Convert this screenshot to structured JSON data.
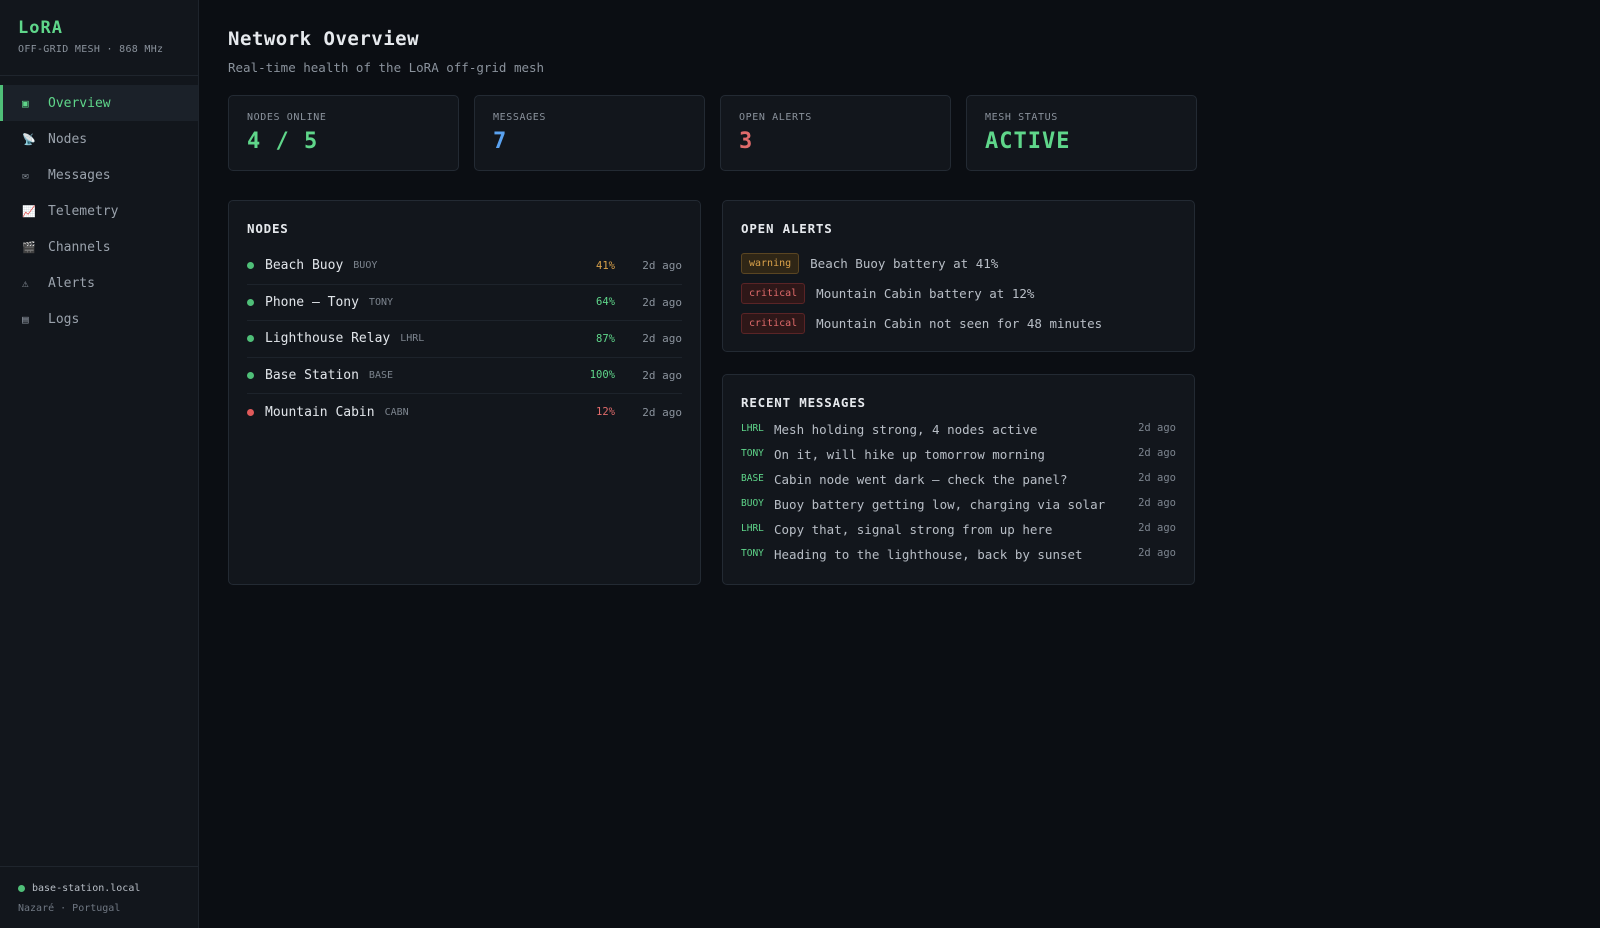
{
  "brand": {
    "title": "LoRA",
    "subtitle": "OFF-GRID MESH · 868 MHz"
  },
  "sidebar": {
    "items": [
      {
        "label": "Overview",
        "icon": "overview-icon",
        "glyph": "▣",
        "active": true
      },
      {
        "label": "Nodes",
        "icon": "satellite-dish-icon",
        "glyph": "📡",
        "active": false
      },
      {
        "label": "Messages",
        "icon": "envelope-icon",
        "glyph": "✉",
        "active": false
      },
      {
        "label": "Telemetry",
        "icon": "chart-icon",
        "glyph": "📈",
        "active": false
      },
      {
        "label": "Channels",
        "icon": "clapper-icon",
        "glyph": "🎬",
        "active": false
      },
      {
        "label": "Alerts",
        "icon": "warning-icon",
        "glyph": "⚠",
        "active": false
      },
      {
        "label": "Logs",
        "icon": "log-icon",
        "glyph": "▤",
        "active": false
      }
    ],
    "footer": {
      "host": "base-station.local",
      "location": "Nazaré · Portugal"
    }
  },
  "header": {
    "title": "Network Overview",
    "subtitle": "Real-time health of the LoRA off-grid mesh"
  },
  "stats": [
    {
      "label": "NODES ONLINE",
      "value": "4 / 5",
      "color": "#5fd68a"
    },
    {
      "label": "MESSAGES",
      "value": "7",
      "color": "#5aa2f0"
    },
    {
      "label": "OPEN ALERTS",
      "value": "3",
      "color": "#e06b6b"
    },
    {
      "label": "MESH STATUS",
      "value": "ACTIVE",
      "color": "#5fd68a"
    }
  ],
  "nodes": {
    "title": "NODES",
    "rows": [
      {
        "name": "Beach Buoy",
        "code": "BUOY",
        "battery": "41%",
        "battery_color": "#d9a14a",
        "status_color": "#4fbf78",
        "last_seen": "2d ago"
      },
      {
        "name": "Phone — Tony",
        "code": "TONY",
        "battery": "64%",
        "battery_color": "#5fd68a",
        "status_color": "#4fbf78",
        "last_seen": "2d ago"
      },
      {
        "name": "Lighthouse Relay",
        "code": "LHRL",
        "battery": "87%",
        "battery_color": "#5fd68a",
        "status_color": "#4fbf78",
        "last_seen": "2d ago"
      },
      {
        "name": "Base Station",
        "code": "BASE",
        "battery": "100%",
        "battery_color": "#5fd68a",
        "status_color": "#4fbf78",
        "last_seen": "2d ago"
      },
      {
        "name": "Mountain Cabin",
        "code": "CABN",
        "battery": "12%",
        "battery_color": "#e06b6b",
        "status_color": "#e05a5a",
        "last_seen": "2d ago"
      }
    ]
  },
  "alerts": {
    "title": "OPEN ALERTS",
    "rows": [
      {
        "level": "warning",
        "text": "Beach Buoy battery at 41%"
      },
      {
        "level": "critical",
        "text": "Mountain Cabin battery at 12%"
      },
      {
        "level": "critical",
        "text": "Mountain Cabin not seen for 48 minutes"
      }
    ]
  },
  "messages": {
    "title": "RECENT MESSAGES",
    "rows": [
      {
        "from": "LHRL",
        "text": "Mesh holding strong, 4 nodes active",
        "time": "2d ago"
      },
      {
        "from": "TONY",
        "text": "On it, will hike up tomorrow morning",
        "time": "2d ago"
      },
      {
        "from": "BASE",
        "text": "Cabin node went dark — check the panel?",
        "time": "2d ago"
      },
      {
        "from": "BUOY",
        "text": "Buoy battery getting low, charging via solar",
        "time": "2d ago"
      },
      {
        "from": "LHRL",
        "text": "Copy that, signal strong from up here",
        "time": "2d ago"
      },
      {
        "from": "TONY",
        "text": "Heading to the lighthouse, back by sunset",
        "time": "2d ago"
      }
    ]
  }
}
